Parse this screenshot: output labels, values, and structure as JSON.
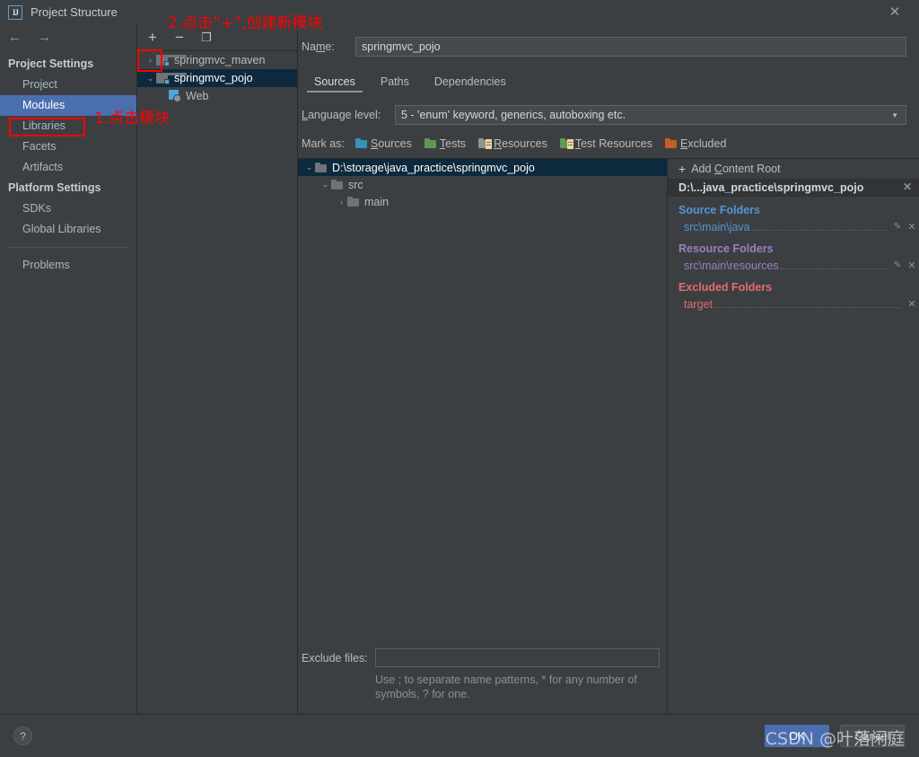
{
  "window": {
    "title": "Project Structure",
    "app_icon": "IJ",
    "close_icon": "✕"
  },
  "nav": {
    "back_icon": "←",
    "forward_icon": "→"
  },
  "sidebar": {
    "groups": [
      {
        "label": "Project Settings",
        "items": [
          {
            "label": "Project",
            "selected": false
          },
          {
            "label": "Modules",
            "selected": true
          },
          {
            "label": "Libraries",
            "selected": false
          },
          {
            "label": "Facets",
            "selected": false
          },
          {
            "label": "Artifacts",
            "selected": false
          }
        ]
      },
      {
        "label": "Platform Settings",
        "items": [
          {
            "label": "SDKs",
            "selected": false
          },
          {
            "label": "Global Libraries",
            "selected": false
          }
        ]
      }
    ],
    "footer_item": {
      "label": "Problems"
    }
  },
  "modules_pane": {
    "toolbar": {
      "add_label": "+",
      "remove_label": "−",
      "copy_label": "❐"
    },
    "tree": [
      {
        "label": "springmvc_maven",
        "twisty": "›",
        "indent": 0,
        "selected": false,
        "icon": "module-folder-icon"
      },
      {
        "label": "springmvc_pojo",
        "twisty": "⌄",
        "indent": 0,
        "selected": true,
        "icon": "module-folder-icon"
      },
      {
        "label": "Web",
        "twisty": "",
        "indent": 1,
        "selected": false,
        "icon": "web-facet-icon"
      }
    ]
  },
  "main": {
    "name_field": {
      "label_pre": "Na",
      "label_mnemonic": "m",
      "label_post": "e:",
      "value": "springmvc_pojo"
    },
    "tabs": [
      {
        "label": "Sources",
        "active": true
      },
      {
        "label": "Paths",
        "active": false
      },
      {
        "label": "Dependencies",
        "active": false
      }
    ],
    "language_level": {
      "label_mnemonic": "L",
      "label_rest": "anguage level:",
      "value": "5 - 'enum' keyword, generics, autoboxing etc.",
      "caret_icon": "▼"
    },
    "mark_as": {
      "label": "Mark as:",
      "options": [
        {
          "label_mnemonic": "S",
          "label_rest": "ources",
          "color": "#3592b5",
          "lined": false
        },
        {
          "label_mnemonic": "T",
          "label_rest": "ests",
          "color": "#629755",
          "lined": false
        },
        {
          "label_mnemonic": "R",
          "label_rest": "esources",
          "color": "#8f9296",
          "lined": true
        },
        {
          "label_mnemonic": "T",
          "label_rest": "est Resources",
          "color": "#629755",
          "lined": true
        },
        {
          "label_mnemonic": "E",
          "label_rest": "xcluded",
          "color": "#c75b29",
          "lined": false
        }
      ]
    },
    "source_tree": [
      {
        "label": "D:\\storage\\java_practice\\springmvc_pojo",
        "twisty": "⌄",
        "indent": 0,
        "selected": true
      },
      {
        "label": "src",
        "twisty": "⌄",
        "indent": 1,
        "selected": false
      },
      {
        "label": "main",
        "twisty": "›",
        "indent": 2,
        "selected": false
      }
    ],
    "exclude_files": {
      "label": "Exclude files:",
      "value": "",
      "hint": "Use ; to separate name patterns, * for any number of symbols, ? for one."
    }
  },
  "content_roots": {
    "add_root": {
      "plus_icon": "+",
      "label_pre": "Add ",
      "label_mnemonic": "C",
      "label_post": "ontent Root"
    },
    "header": {
      "label": "D:\\...java_practice\\springmvc_pojo",
      "close_icon": "✕"
    },
    "groups": [
      {
        "title": "Source Folders",
        "kind": "src",
        "items": [
          {
            "path": "src\\main\\java",
            "has_pencil": true,
            "pencil_icon": "✎",
            "close_icon": "✕"
          }
        ]
      },
      {
        "title": "Resource Folders",
        "kind": "res",
        "items": [
          {
            "path": "src\\main\\resources",
            "has_pencil": true,
            "pencil_icon": "✎",
            "close_icon": "✕"
          }
        ]
      },
      {
        "title": "Excluded Folders",
        "kind": "exc",
        "items": [
          {
            "path": "target",
            "has_pencil": false,
            "pencil_icon": "",
            "close_icon": "✕"
          }
        ]
      }
    ]
  },
  "bottom": {
    "help_icon": "?",
    "ok_label": "OK",
    "cancel_label": "Cancel"
  },
  "annotations": [
    {
      "id": "step1",
      "text": "1.点击模块"
    },
    {
      "id": "step2",
      "text": "2.点击“+”,创建新模块"
    }
  ],
  "watermark": {
    "text": "CSDN @叶落闲庭"
  },
  "colors": {
    "selection_blue": "#4b6eaf",
    "tree_selection": "#0d293e",
    "annotation_red": "#ff0000",
    "source_folder": "#5394d6",
    "resource_folder": "#9b7fc0",
    "excluded_folder": "#e26b6b",
    "dialog_bg": "#3c3f41"
  }
}
